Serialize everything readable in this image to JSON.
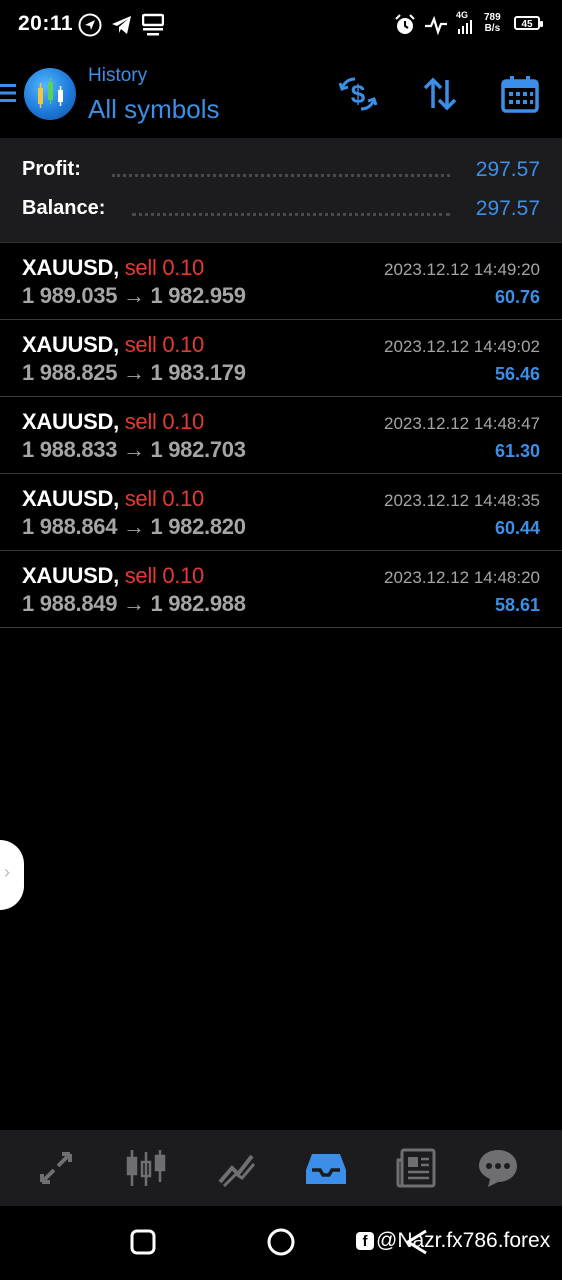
{
  "status_bar": {
    "time": "20:11",
    "net_speed_value": "789",
    "net_speed_unit": "B/s",
    "network_type": "4G",
    "battery_level": "45"
  },
  "header": {
    "subtitle": "History",
    "title": "All symbols"
  },
  "summary": {
    "profit_label": "Profit:",
    "profit_value": "297.57",
    "balance_label": "Balance:",
    "balance_value": "297.57"
  },
  "deals": [
    {
      "symbol": "XAUUSD,",
      "type": "sell 0.10",
      "prices": "1 989.035 → 1 982.959",
      "time": "2023.12.12 14:49:20",
      "profit": "60.76"
    },
    {
      "symbol": "XAUUSD,",
      "type": "sell 0.10",
      "prices": "1 988.825 → 1 983.179",
      "time": "2023.12.12 14:49:02",
      "profit": "56.46"
    },
    {
      "symbol": "XAUUSD,",
      "type": "sell 0.10",
      "prices": "1 988.833 → 1 982.703",
      "time": "2023.12.12 14:48:47",
      "profit": "61.30"
    },
    {
      "symbol": "XAUUSD,",
      "type": "sell 0.10",
      "prices": "1 988.864 → 1 982.820",
      "time": "2023.12.12 14:48:35",
      "profit": "60.44"
    },
    {
      "symbol": "XAUUSD,",
      "type": "sell 0.10",
      "prices": "1 988.849 → 1 982.988",
      "time": "2023.12.12 14:48:20",
      "profit": "58.61"
    }
  ],
  "bottom_tabs": [
    {
      "icon": "quotes-icon",
      "active": false
    },
    {
      "icon": "chart-candles-icon",
      "active": false
    },
    {
      "icon": "trade-icon",
      "active": false
    },
    {
      "icon": "history-inbox-icon",
      "active": true
    },
    {
      "icon": "news-icon",
      "active": false
    },
    {
      "icon": "chat-icon",
      "active": false
    }
  ],
  "watermark": "@Nazr.fx786.forex",
  "colors": {
    "accent": "#3b8fe8",
    "sell": "#e53935",
    "muted_text": "#a5a5a5",
    "panel": "#1c1c1e"
  }
}
